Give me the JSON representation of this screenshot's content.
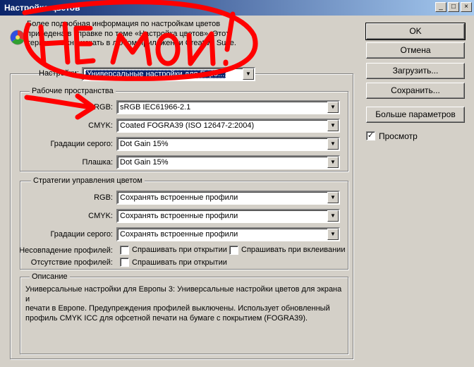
{
  "window": {
    "title": "Настройка цветов",
    "controls": [
      "minimize-icon",
      "maximize-icon",
      "close-icon"
    ]
  },
  "info": {
    "lines": [
      "Более подробная информация по настройкам цветов",
      "приведена в справке по теме «Настройка цветов». Этот",
      "термин можно искать в любом приложении Creative Suite."
    ]
  },
  "settings": {
    "label": "Настройки:",
    "value": "Универсальные настройки для Евро..."
  },
  "workspaces": {
    "legend": "Рабочие пространства",
    "rows": [
      {
        "label": "RGB:",
        "value": "sRGB IEC61966-2.1"
      },
      {
        "label": "CMYK:",
        "value": "Coated FOGRA39 (ISO 12647-2:2004)"
      },
      {
        "label": "Градации серого:",
        "value": "Dot Gain 15%"
      },
      {
        "label": "Плашка:",
        "value": "Dot Gain 15%"
      }
    ]
  },
  "policies": {
    "legend": "Стратегии управления цветом",
    "rows": [
      {
        "label": "RGB:",
        "value": "Сохранять встроенные профили"
      },
      {
        "label": "CMYK:",
        "value": "Сохранять встроенные профили"
      },
      {
        "label": "Градации серого:",
        "value": "Сохранять встроенные профили"
      }
    ],
    "mismatch_label": "Несовпадение профилей:",
    "mismatch_open": "Спрашивать при открытии",
    "mismatch_paste": "Спрашивать при вклеивании",
    "missing_label": "Отсутствие профилей:",
    "missing_open": "Спрашивать при открытии"
  },
  "description": {
    "legend": "Описание",
    "lines": [
      "Универсальные настройки для Европы 3:  Универсальные настройки цветов для экрана и",
      "печати в Европе. Предупреждения профилей выключены. Использует обновленный",
      "профиль CMYK ICC для офсетной печати на бумаге с покрытием (FOGRA39)."
    ]
  },
  "buttons": {
    "ok": "OK",
    "cancel": "Отмена",
    "load": "Загрузить...",
    "save": "Сохранить...",
    "more": "Больше параметров"
  },
  "preview": {
    "label": "Просмотр",
    "checked": true
  },
  "annotation": {
    "text": "НЕ МОИ!",
    "color": "#ff0000"
  }
}
